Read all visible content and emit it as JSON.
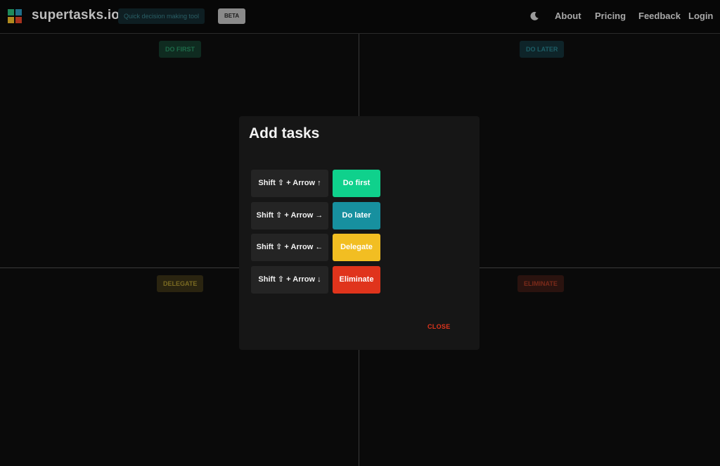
{
  "header": {
    "brand": "supertasks.io",
    "tagline": "Quick decision making tool",
    "badge": "BETA",
    "nav": [
      "About",
      "Pricing",
      "Feedback",
      "Login"
    ],
    "theme_icon": "moon-icon"
  },
  "quadrants": {
    "do_first": "DO FIRST",
    "do_later": "DO LATER",
    "delegate": "DELEGATE",
    "eliminate": "ELIMINATE"
  },
  "modal": {
    "title": "Add tasks",
    "rows": [
      {
        "shortcut": "Shift ⇧ + Arrow ↑",
        "action": "Do first"
      },
      {
        "shortcut": "Shift ⇧ + Arrow →",
        "action": "Do later"
      },
      {
        "shortcut": "Shift ⇧ + Arrow ←",
        "action": "Delegate"
      },
      {
        "shortcut": "Shift ⇧ + Arrow ↓",
        "action": "Eliminate"
      }
    ],
    "close": "CLOSE"
  },
  "colors": {
    "do_first": "#0fd18c",
    "do_later": "#17909f",
    "delegate": "#f2be22",
    "eliminate": "#e0341c"
  }
}
